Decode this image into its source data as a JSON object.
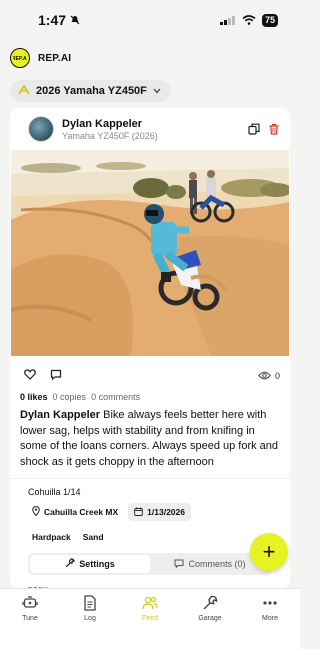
{
  "status_bar": {
    "time": "1:47",
    "battery": "75"
  },
  "app": {
    "title": "REP.AI",
    "logo_text": "REP.AI"
  },
  "bike_selector": {
    "label": "2026 Yamaha YZ450F"
  },
  "post": {
    "author": "Dylan Kappeler",
    "bike": "Yamaha YZ450F (2026)",
    "likes": "0 likes",
    "copies": "0 copies",
    "comments": "0 comments",
    "views": "0",
    "caption_author": "Dylan Kappeler",
    "caption_text": " Bike always feels better here with lower sag, helps with stability and from knifing in some of the loans corners. Always speed up fork and shock as it gets choppy in the afternoon",
    "session_name": "Cohuilla 1/14",
    "location": "Cahuilla Creek MX",
    "date": "1/13/2026",
    "tags": [
      "Hardpack",
      "Sand"
    ],
    "tabs": {
      "settings": "Settings",
      "comments": "Comments (0)"
    },
    "section_label": "FORK"
  },
  "fab": {
    "label": "+"
  },
  "nav": [
    {
      "label": "Tune",
      "icon": "motor-icon"
    },
    {
      "label": "Log",
      "icon": "document-icon"
    },
    {
      "label": "Feed",
      "icon": "people-icon"
    },
    {
      "label": "Garage",
      "icon": "wrench-icon"
    },
    {
      "label": "More",
      "icon": "more-dots-icon"
    }
  ],
  "colors": {
    "accent": "#e6f221",
    "nav_active": "#c9d400",
    "delete": "#e0302a"
  }
}
